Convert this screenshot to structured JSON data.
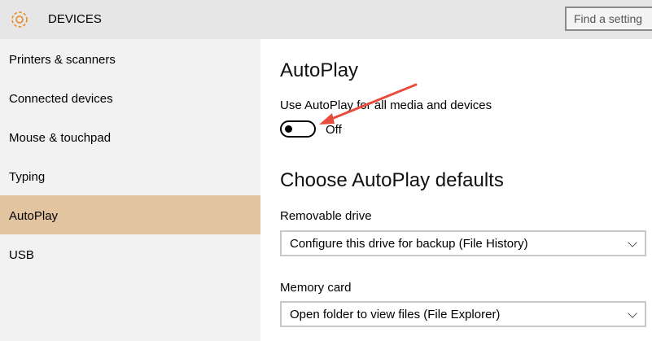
{
  "header": {
    "title": "DEVICES",
    "search_placeholder": "Find a setting"
  },
  "sidebar": {
    "items": [
      {
        "label": "Printers & scanners"
      },
      {
        "label": "Connected devices"
      },
      {
        "label": "Mouse & touchpad"
      },
      {
        "label": "Typing"
      },
      {
        "label": "AutoPlay",
        "selected": true
      },
      {
        "label": "USB"
      }
    ]
  },
  "main": {
    "title": "AutoPlay",
    "toggle_label": "Use AutoPlay for all media and devices",
    "toggle_state": "Off",
    "defaults_title": "Choose AutoPlay defaults",
    "removable_label": "Removable drive",
    "removable_value": "Configure this drive for backup (File History)",
    "memory_label": "Memory card",
    "memory_value": "Open folder to view files (File Explorer)"
  },
  "colors": {
    "accent": "#e2c4a0",
    "gear": "#e8871e",
    "arrow": "#e84c3d"
  }
}
